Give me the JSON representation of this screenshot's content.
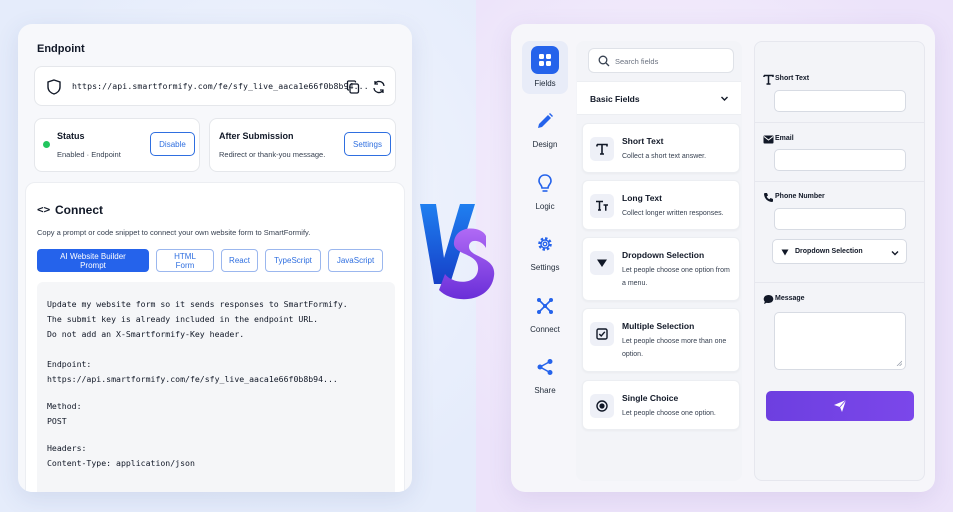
{
  "left": {
    "endpoint_title": "Endpoint",
    "endpoint_url": "https://api.smartformify.com/fe/sfy_live_aaca1e66f0b8b94...",
    "status": {
      "title": "Status",
      "value": "Enabled · Endpoint",
      "button": "Disable",
      "dot_color": "#22c55e"
    },
    "after_submission": {
      "title": "After Submission",
      "desc": "Redirect or thank-you message.",
      "button": "Settings"
    },
    "connect": {
      "icon_text": "<>",
      "title": "Connect",
      "desc": "Copy a prompt or code snippet to connect your own website form to SmartFormify.",
      "tabs": [
        "AI Website Builder Prompt",
        "HTML Form",
        "React",
        "TypeScript",
        "JavaScript"
      ],
      "active_tab": "AI Website Builder Prompt",
      "code_lines": [
        "Update my website form so it sends responses to SmartFormify.",
        "The submit key is already included in the endpoint URL.",
        "Do not add an X-Smartformify-Key header.",
        "",
        "Endpoint:",
        "https://api.smartformify.com/fe/sfy_live_aaca1e66f0b8b94...",
        "",
        "Method:",
        "POST",
        "",
        "Headers:",
        "Content-Type: application/json"
      ]
    }
  },
  "right": {
    "rail": [
      {
        "label": "Fields",
        "icon": "grid-icon"
      },
      {
        "label": "Design",
        "icon": "pen-icon"
      },
      {
        "label": "Logic",
        "icon": "bulb-icon"
      },
      {
        "label": "Settings",
        "icon": "gear-icon"
      },
      {
        "label": "Connect",
        "icon": "network-icon"
      },
      {
        "label": "Share",
        "icon": "share-icon"
      }
    ],
    "search_placeholder": "Search fields",
    "basic_fields_title": "Basic Fields",
    "fields": [
      {
        "title": "Short Text",
        "desc": "Collect a short text answer.",
        "icon": "T"
      },
      {
        "title": "Long Text",
        "desc": "Collect longer written responses.",
        "icon": "Tt"
      },
      {
        "title": "Dropdown Selection",
        "desc": "Let people choose one option from a menu.",
        "icon": "triangle"
      },
      {
        "title": "Multiple Selection",
        "desc": "Let people choose more than one option.",
        "icon": "checkbox"
      },
      {
        "title": "Single Choice",
        "desc": "Let people choose one option.",
        "icon": "radio"
      }
    ],
    "preview": {
      "short_text_label": "Short Text",
      "email_label": "Email",
      "phone_label": "Phone Number",
      "dropdown_label": "Dropdown Selection",
      "message_label": "Message"
    },
    "accent_color": "#2563eb",
    "submit_color": "#6d3fe0"
  }
}
